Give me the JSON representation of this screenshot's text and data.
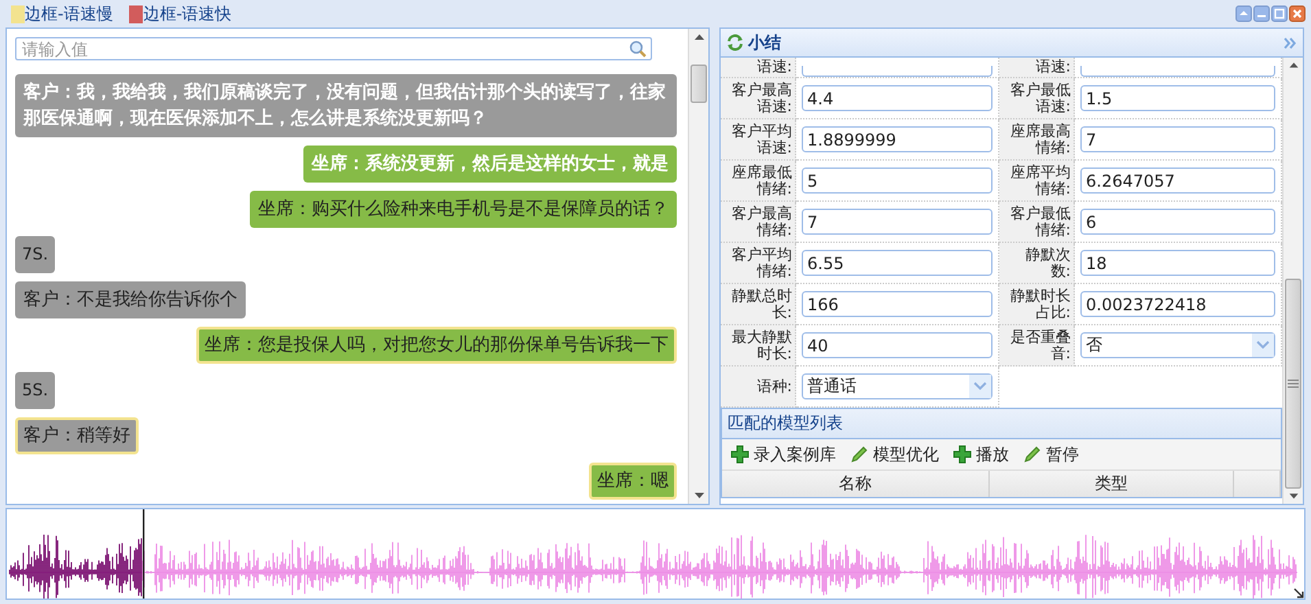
{
  "legend": [
    {
      "label": "边框-语速慢",
      "color": "#f3e38f"
    },
    {
      "label": "边框-语速快",
      "color": "#d25c5c"
    }
  ],
  "chat": {
    "search": {
      "placeholder": "请输入值"
    },
    "messages": [
      {
        "kind": "customer",
        "text": "客户：我，我给我，我们原稿谈完了，没有问题，但我估计那个头的读写了，往家那医保通啊，现在医保添加不上，怎么讲是系统没更新吗？",
        "highlighted": true,
        "slow": false
      },
      {
        "kind": "agent",
        "text": "坐席：系统没更新，然后是这样的女士，就是",
        "highlighted": true,
        "slow": false
      },
      {
        "kind": "agent",
        "text": "坐席：购买什么险种来电手机号是不是保障员的话？",
        "highlighted": false,
        "slow": false
      },
      {
        "kind": "duration",
        "text": "7S."
      },
      {
        "kind": "customer",
        "text": "客户：不是我给你告诉你个",
        "highlighted": false,
        "slow": false
      },
      {
        "kind": "agent",
        "text": "坐席：您是投保人吗，对把您女儿的那份保单号告诉我一下",
        "highlighted": false,
        "slow": true
      },
      {
        "kind": "duration",
        "text": "5S."
      },
      {
        "kind": "customer",
        "text": "客户：稍等好",
        "highlighted": false,
        "slow": true
      },
      {
        "kind": "agent",
        "text": "坐席：嗯",
        "highlighted": false,
        "slow": true
      }
    ]
  },
  "summary": {
    "title": "小结",
    "fields": [
      {
        "label": "语速:",
        "kind": "text"
      },
      {
        "label": "语速:",
        "kind": "text"
      },
      {
        "label": "客户最高语速:",
        "value": "4.4",
        "kind": "text"
      },
      {
        "label": "客户最低语速:",
        "value": "1.5",
        "kind": "text"
      },
      {
        "label": "客户平均语速:",
        "value": "1.8899999",
        "kind": "text"
      },
      {
        "label": "座席最高情绪:",
        "value": "7",
        "kind": "text"
      },
      {
        "label": "座席最低情绪:",
        "value": "5",
        "kind": "text"
      },
      {
        "label": "座席平均情绪:",
        "value": "6.2647057",
        "kind": "text"
      },
      {
        "label": "客户最高情绪:",
        "value": "7",
        "kind": "text"
      },
      {
        "label": "客户最低情绪:",
        "value": "6",
        "kind": "text"
      },
      {
        "label": "客户平均情绪:",
        "value": "6.55",
        "kind": "text"
      },
      {
        "label": "静默次数:",
        "value": "18",
        "kind": "text"
      },
      {
        "label": "静默总时长:",
        "value": "166",
        "kind": "text"
      },
      {
        "label": "静默时长占比:",
        "value": "0.0023722418",
        "kind": "text"
      },
      {
        "label": "最大静默时长:",
        "value": "40",
        "kind": "text"
      },
      {
        "label": "是否重叠音:",
        "value": "否",
        "kind": "select"
      },
      {
        "label": "语种:",
        "value": "普通话",
        "kind": "select"
      }
    ],
    "models": {
      "title": "匹配的模型列表",
      "toolbar": [
        {
          "label": "录入案例库",
          "kind": "add"
        },
        {
          "label": "模型优化",
          "kind": "edit"
        },
        {
          "label": "播放",
          "kind": "add"
        },
        {
          "label": "暂停",
          "kind": "edit"
        }
      ],
      "columns": [
        "名称",
        "类型"
      ]
    }
  },
  "waveform": {
    "level": 0.105
  }
}
